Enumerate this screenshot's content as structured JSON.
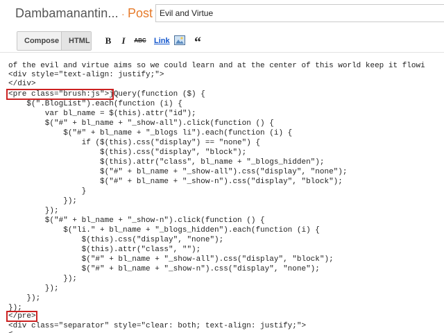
{
  "header": {
    "blog_title": "Dambamanantin...",
    "separator": "·",
    "post_label": "Post",
    "post_title_value": "Evil and Virtue"
  },
  "toolbar": {
    "compose_label": "Compose",
    "html_label": "HTML",
    "bold_label": "B",
    "italic_label": "I",
    "strike_label": "ABC",
    "link_label": "Link",
    "quote_label": "“"
  },
  "icons": {
    "image": "image-icon",
    "quote": "quote-icon",
    "bold": "bold-icon",
    "italic": "italic-icon",
    "strike": "strikethrough-icon"
  },
  "colors": {
    "post_accent": "#e67a2a",
    "link": "#1155cc",
    "highlight": "#cc2222"
  },
  "editor": {
    "lines": [
      "of the evil and virtue aims so we could learn and at the center of this world keep it flowi",
      "<div style=\"text-align: justify;\">",
      "</div>",
      "<pre class=\"brush:js\">jQuery(function ($) {",
      "    $(\".BlogList\").each(function (i) {",
      "        var bl_name = $(this).attr(\"id\");",
      "        $(\"#\" + bl_name + \"_show-all\").click(function () {",
      "            $(\"#\" + bl_name + \"_blogs li\").each(function (i) {",
      "                if ($(this).css(\"display\") == \"none\") {",
      "                    $(this).css(\"display\", \"block\");",
      "                    $(this).attr(\"class\", bl_name + \"_blogs_hidden\");",
      "                    $(\"#\" + bl_name + \"_show-all\").css(\"display\", \"none\");",
      "                    $(\"#\" + bl_name + \"_show-n\").css(\"display\", \"block\");",
      "                }",
      "            });",
      "        });",
      "        $(\"#\" + bl_name + \"_show-n\").click(function () {",
      "            $(\"li.\" + bl_name + \"_blogs_hidden\").each(function (i) {",
      "                $(this).css(\"display\", \"none\");",
      "                $(this).attr(\"class\", \"\");",
      "                $(\"#\" + bl_name + \"_show-all\").css(\"display\", \"block\");",
      "                $(\"#\" + bl_name + \"_show-n\").css(\"display\", \"none\");",
      "            });",
      "        });",
      "    });",
      "});",
      "</pre>",
      "<div class=\"separator\" style=\"clear: both; text-align: justify;\">",
      "<"
    ]
  }
}
